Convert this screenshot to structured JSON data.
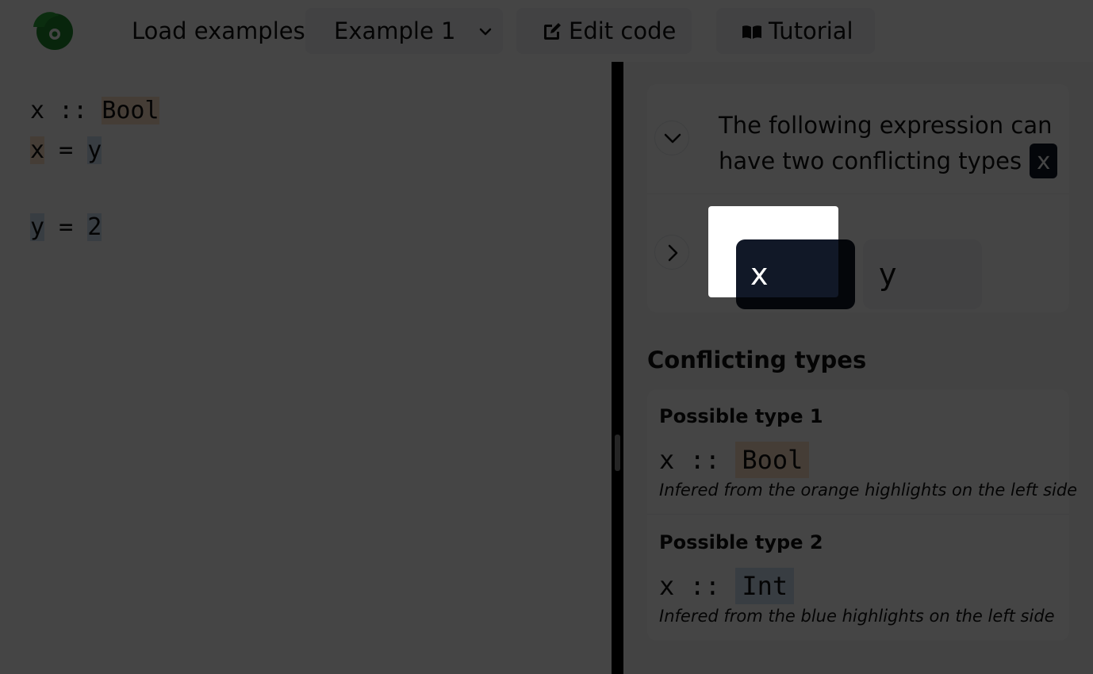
{
  "header": {
    "load_label": "Load examples:",
    "example_select": {
      "selected": "Example 1"
    },
    "edit_code_label": "Edit code",
    "tutorial_label": "Tutorial"
  },
  "editor": {
    "lines": [
      {
        "tokens": [
          "x",
          " :: ",
          "Bool"
        ]
      },
      {
        "tokens": [
          "x",
          " = ",
          "y"
        ]
      },
      {
        "tokens": [
          "y",
          " = ",
          "2"
        ]
      }
    ]
  },
  "expression_card": {
    "message": "The following expression can have two conflicting types",
    "token": "x",
    "sequence": [
      "x",
      "y"
    ]
  },
  "conflicts": {
    "title": "Conflicting types",
    "types": [
      {
        "heading": "Possible type 1",
        "var": "x",
        "sep": " :: ",
        "type": "Bool",
        "note": "Infered from the orange highlights on the left side"
      },
      {
        "heading": "Possible type 2",
        "var": "x",
        "sep": " :: ",
        "type": "Int",
        "note": "Infered from the blue highlights on the left side"
      }
    ]
  },
  "colors": {
    "orange_highlight": "#fde2c8",
    "blue_highlight": "#cfe0f5",
    "dark_chip": "#111827",
    "logo_green": "#1f8a2c"
  },
  "icons": {
    "logo": "chameleon-logo",
    "edit": "edit-icon",
    "tutorial": "book-icon",
    "dropdown": "chevron-down-icon",
    "collapse": "chevron-down-icon",
    "expand": "chevron-right-icon"
  }
}
